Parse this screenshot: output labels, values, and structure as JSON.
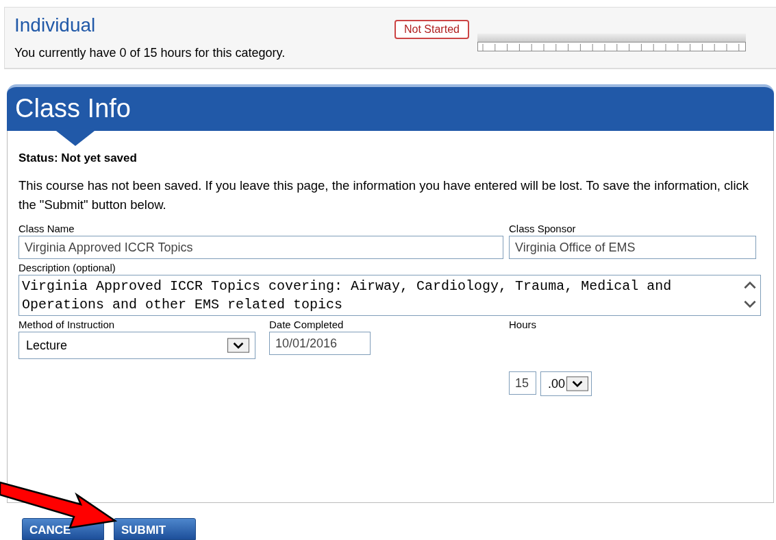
{
  "category": {
    "title": "Individual",
    "summary": "You currently have 0 of 15 hours for this category.",
    "status": "Not Started",
    "level": 0
  },
  "panel": {
    "title": "Class Info",
    "status_label": "Status: Not yet saved",
    "notice": "This course has not been saved. If you leave this page, the information you have entered will be lost. To save the information, click the \"Submit\" button below."
  },
  "fields": {
    "class_name": {
      "label": "Class Name",
      "value": "Virginia Approved ICCR Topics"
    },
    "class_sponsor": {
      "label": "Class Sponsor",
      "value": "Virginia Office of EMS"
    },
    "description": {
      "label": "Description (optional)",
      "value": "Virginia Approved ICCR Topics covering: Airway, Cardiology, Trauma, Medical and Operations and other EMS related topics"
    },
    "method": {
      "label": "Method of Instruction",
      "value": "Lecture"
    },
    "date": {
      "label": "Date Completed",
      "value": "10/01/2016"
    },
    "hours": {
      "label": "Hours",
      "whole": "15",
      "fraction": ".00"
    }
  },
  "buttons": [
    {
      "label": "CANCE"
    },
    {
      "label": "SUBMIT"
    }
  ]
}
